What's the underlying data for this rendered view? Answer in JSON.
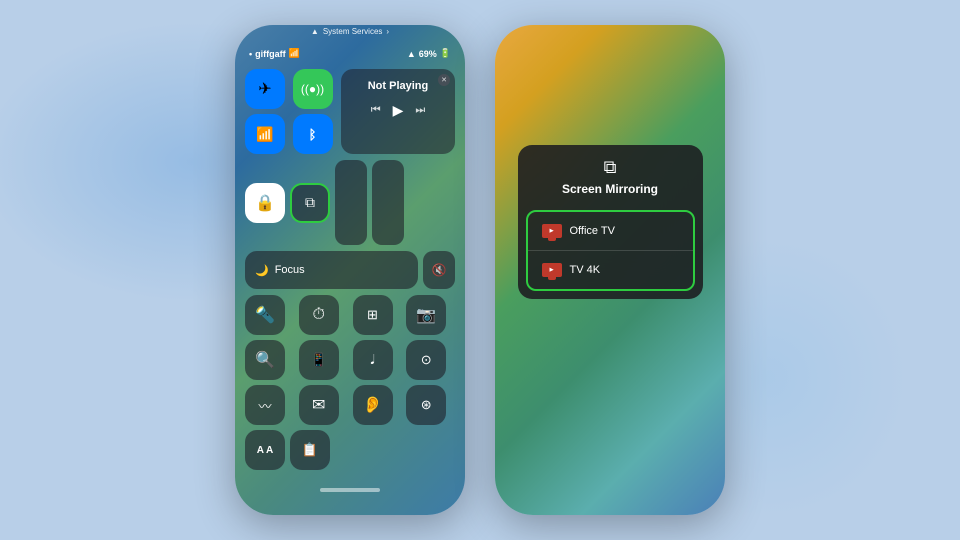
{
  "background": {
    "color": "#b8cfe8"
  },
  "left_panel": {
    "status_bar": {
      "carrier": "giffgaff",
      "wifi": true,
      "location": true,
      "battery": "69%"
    },
    "system_services": {
      "label": "System Services",
      "arrow": "›"
    },
    "connectivity": {
      "airplane_mode": "✈",
      "cellular": "◉",
      "wifi": "wifi",
      "bluetooth": "bluetooth"
    },
    "now_playing": {
      "title": "Not Playing"
    },
    "focus": {
      "icon": "🌙",
      "label": "Focus"
    },
    "screen_mirror": {
      "icon": "⧉",
      "active": true
    },
    "grid_rows": [
      [
        "🔦",
        "⏱",
        "⣿",
        "📷"
      ],
      [
        "🔍",
        "📺",
        "𝅘𝅥𝅮",
        "⊙"
      ],
      [
        "〰",
        "✉",
        "👂",
        "⊛"
      ]
    ],
    "bottom_row": {
      "text_size": "A A",
      "notes": "📋"
    }
  },
  "right_panel": {
    "popup": {
      "icon": "⧉",
      "title": "Screen Mirroring",
      "devices": [
        {
          "name": "Office TV",
          "icon_color": "#c0392b"
        },
        {
          "name": "TV 4K",
          "icon_color": "#c0392b"
        }
      ]
    }
  }
}
